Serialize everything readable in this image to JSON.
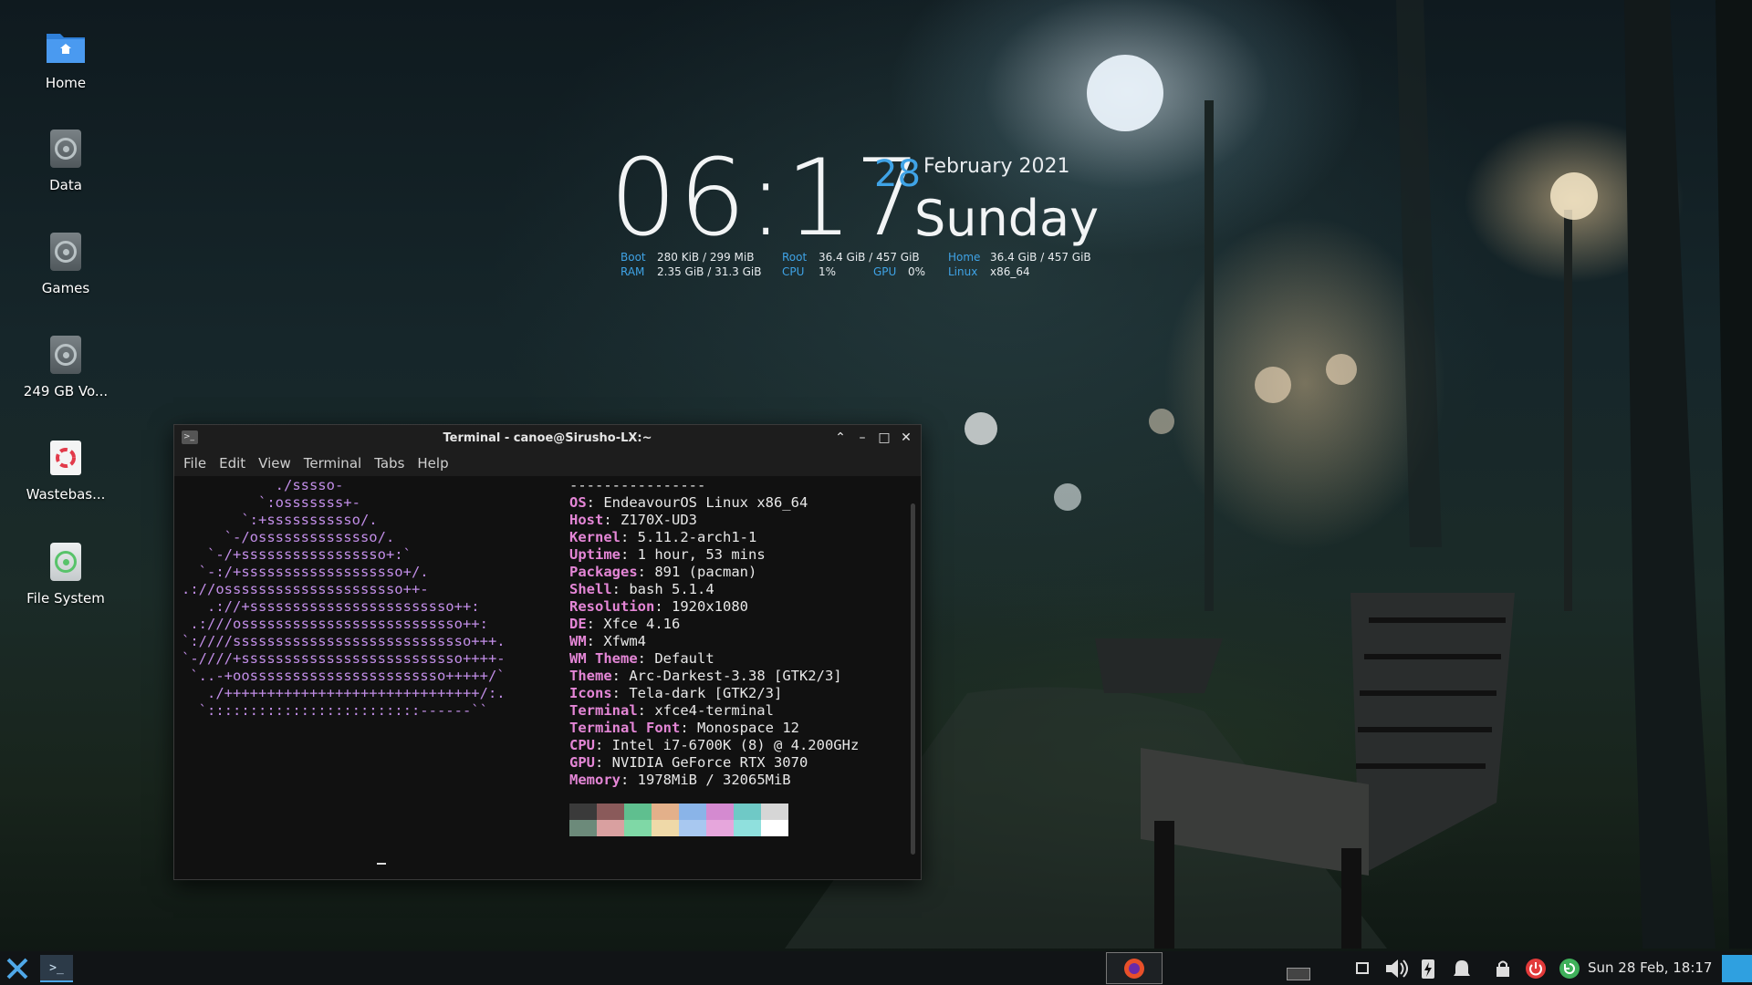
{
  "desktop": {
    "icons": [
      {
        "label": "Home",
        "icon": "home-folder-icon"
      },
      {
        "label": "Data",
        "icon": "drive-icon"
      },
      {
        "label": "Games",
        "icon": "drive-icon"
      },
      {
        "label": "249 GB Vo...",
        "icon": "drive-icon"
      },
      {
        "label": "Wastebas...",
        "icon": "trash-icon"
      },
      {
        "label": "File System",
        "icon": "drive-icon"
      }
    ]
  },
  "conky": {
    "time": "06:17",
    "day": "28",
    "month_year": "February 2021",
    "weekday": "Sunday",
    "stats": {
      "boot_label": "Boot",
      "boot_value": "280 KiB / 299 MiB",
      "ram_label": "RAM",
      "ram_value": "2.35 GiB / 31.3 GiB",
      "root_label": "Root",
      "root_value": "36.4 GiB / 457 GiB",
      "cpu_label": "CPU",
      "cpu_value": "1%",
      "gpu_label": "GPU",
      "gpu_value": "0%",
      "home_label": "Home",
      "home_value": "36.4 GiB / 457 GiB",
      "linux_label": "Linux",
      "linux_value": "x86_64"
    },
    "accent": "#3fa3e6"
  },
  "terminal": {
    "title": "Terminal - canoe@Sirusho-LX:~",
    "menu": [
      "File",
      "Edit",
      "View",
      "Terminal",
      "Tabs",
      "Help"
    ],
    "logo_lines": [
      "           ./sssso-",
      "         `:osssssss+-",
      "       `:+sssssssssso/.",
      "     `-/ossssssssssssso/.",
      "   `-/+sssssssssssssssso+:`",
      "  `-:/+sssssssssssssssssso+/.",
      ".://osssssssssssssssssssso++-",
      "   .://+ssssssssssssssssssssssso++:",
      " .:///ossssssssssssssssssssssssso++:",
      "`:////ssssssssssssssssssssssssssso+++.",
      "`-////+ssssssssssssssssssssssssso++++-",
      " `..-+oosssssssssssssssssssssso+++++/`",
      "   ./++++++++++++++++++++++++++++++/:.",
      "  `:::::::::::::::::::::::::------``"
    ],
    "separator": "----------------",
    "info": [
      {
        "key": "OS",
        "value": "EndeavourOS Linux x86_64"
      },
      {
        "key": "Host",
        "value": "Z170X-UD3"
      },
      {
        "key": "Kernel",
        "value": "5.11.2-arch1-1"
      },
      {
        "key": "Uptime",
        "value": "1 hour, 53 mins"
      },
      {
        "key": "Packages",
        "value": "891 (pacman)"
      },
      {
        "key": "Shell",
        "value": "bash 5.1.4"
      },
      {
        "key": "Resolution",
        "value": "1920x1080"
      },
      {
        "key": "DE",
        "value": "Xfce 4.16"
      },
      {
        "key": "WM",
        "value": "Xfwm4"
      },
      {
        "key": "WM Theme",
        "value": "Default"
      },
      {
        "key": "Theme",
        "value": "Arc-Darkest-3.38 [GTK2/3]"
      },
      {
        "key": "Icons",
        "value": "Tela-dark [GTK2/3]"
      },
      {
        "key": "Terminal",
        "value": "xfce4-terminal"
      },
      {
        "key": "Terminal Font",
        "value": "Monospace 12"
      },
      {
        "key": "CPU",
        "value": "Intel i7-6700K (8) @ 4.200GHz"
      },
      {
        "key": "GPU",
        "value": "NVIDIA GeForce RTX 3070"
      },
      {
        "key": "Memory",
        "value": "1978MiB / 32065MiB"
      }
    ],
    "palette_top": [
      "#3a3a3a",
      "#8a5a5a",
      "#5fbf8f",
      "#e3b08a",
      "#8ab4e8",
      "#d48ad0",
      "#6fc9c6",
      "#d6d6d6"
    ],
    "palette_bottom": [
      "#6c8a7a",
      "#d9a0a0",
      "#7fd8a6",
      "#efd9a8",
      "#a8c8f0",
      "#e6a6dc",
      "#8fe0dd",
      "#ffffff"
    ],
    "logo_color": "#c28ee8",
    "key_color": "#e486d6"
  },
  "taskbar": {
    "clock": "Sun 28 Feb, 18:17",
    "items": [
      "xfce-menu-icon",
      "terminal-task",
      "firefox-task",
      "workspace-switcher",
      "display-icon",
      "volume-icon",
      "battery-icon",
      "notification-icon",
      "lock-icon",
      "power-icon",
      "update-icon",
      "show-desktop"
    ]
  }
}
